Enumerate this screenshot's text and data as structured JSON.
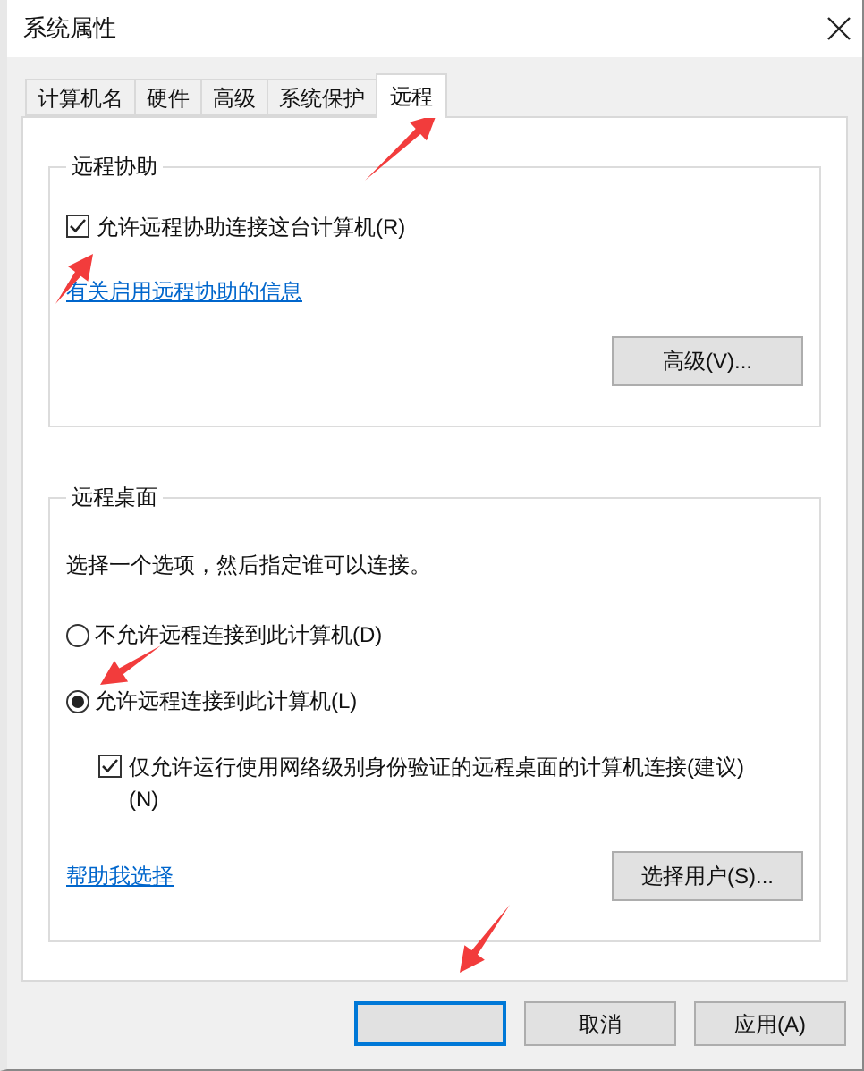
{
  "window": {
    "title": "系统属性"
  },
  "tabs": [
    {
      "label": "计算机名",
      "selected": false
    },
    {
      "label": "硬件",
      "selected": false
    },
    {
      "label": "高级",
      "selected": false
    },
    {
      "label": "系统保护",
      "selected": false
    },
    {
      "label": "远程",
      "selected": true
    }
  ],
  "remote_assistance": {
    "title": "远程协助",
    "allow": {
      "label": "允许远程协助连接这台计算机(R)",
      "checked": true
    },
    "link": "有关启用远程协助的信息",
    "advanced_button": "高级(V)..."
  },
  "remote_desktop": {
    "title": "远程桌面",
    "instruction": "选择一个选项，然后指定谁可以连接。",
    "options": [
      {
        "label": "不允许远程连接到此计算机(D)",
        "selected": false
      },
      {
        "label": "允许远程连接到此计算机(L)",
        "selected": true
      }
    ],
    "nla": {
      "label": "仅允许运行使用网络级别身份验证的远程桌面的计算机连接(建议)(N)",
      "checked": true
    },
    "link": "帮助我选择",
    "select_users_button": "选择用户(S)..."
  },
  "buttons": [
    {
      "kind": "default"
    },
    {
      "kind": "normal",
      "label": "取消"
    },
    {
      "kind": "normal",
      "label": "应用(A)"
    }
  ]
}
